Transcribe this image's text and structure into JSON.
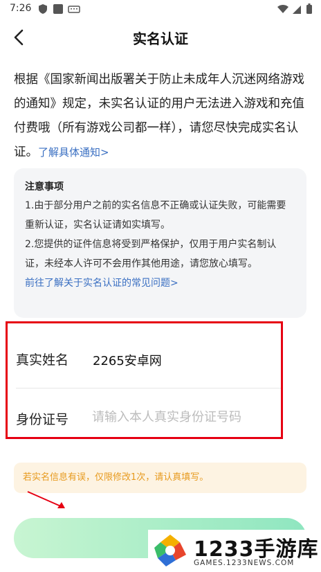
{
  "status_bar": {
    "time": "7:26"
  },
  "header": {
    "title": "实名认证"
  },
  "intro": {
    "text": "根据《国家新闻出版署关于防止未成年人沉迷网络游戏的通知》规定，未实名认证的用户无法进入游戏和充值付费哦（所有游戏公司都一样），请您尽快完成实名认证。",
    "link": "了解具体通知>"
  },
  "notice": {
    "title": "注意事项",
    "item1": "1.由于部分用户之前的实名信息不正确或认证失败，可能需要重新认证，实名认证请如实填写。",
    "item2": "2.您提供的证件信息将受到严格保护，仅用于用户实名制认证，未经本人许可不会用作其他用途，请您放心填写。",
    "link": "前往了解关于实名认证的常见问题>"
  },
  "form": {
    "name_label": "真实姓名",
    "name_value": "2265安卓网",
    "id_label": "身份证号",
    "id_placeholder": "请输入本人真实身份证号码"
  },
  "warning": {
    "text": "若实名信息有误，仅限修改1次，请认真填写。"
  },
  "watermark": {
    "brand": "1233手游库",
    "url": "GAMES.1233NEWS.COM"
  },
  "colors": {
    "link": "#3a6fc2",
    "warning_text": "#e79a1e",
    "warning_bg": "#fdf3e2",
    "highlight_box": "#e60012",
    "button_gradient_start": "#c8f5d2",
    "button_gradient_end": "#8fe6c0"
  }
}
